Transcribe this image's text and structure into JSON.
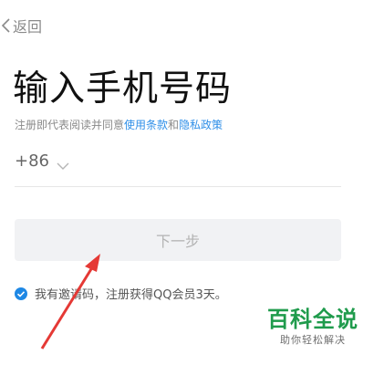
{
  "header": {
    "back_label": "返回"
  },
  "page": {
    "title": "输入手机号码",
    "agreement": {
      "prefix": "注册即代表阅读并同意",
      "terms_link": "使用条款",
      "and": "和",
      "privacy_link": "隐私政策"
    }
  },
  "phone": {
    "country_code": "+86"
  },
  "next_button": {
    "label": "下一步"
  },
  "invite": {
    "label": "我有邀请码，注册获得QQ会员3天。",
    "checked": true
  },
  "watermark": {
    "title": "百科全说",
    "subtitle": "助你轻松解决"
  },
  "colors": {
    "link": "#2f8fe8",
    "check": "#1e88e5",
    "annotation_arrow": "#e53935",
    "watermark": "#1f9b4c"
  }
}
